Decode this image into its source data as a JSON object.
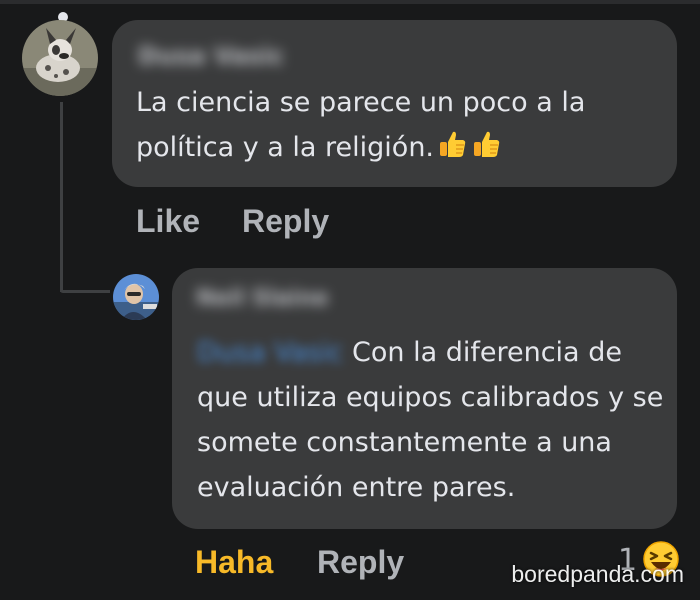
{
  "comments": [
    {
      "author": "Dusa Vasic",
      "text": "La ciencia se parece un poco a la política y a la religión.",
      "emojis": [
        "thumbs-up",
        "thumbs-up"
      ],
      "actions": {
        "like": "Like",
        "reply": "Reply"
      }
    },
    {
      "author": "Neil Slaine",
      "mention": "Dusa Vasic",
      "text": "Con la diferencia de que utiliza equipos calibrados y se somete constantemente a una evaluación entre pares.",
      "actions": {
        "reaction": "Haha",
        "reply": "Reply"
      },
      "reaction_count": "1",
      "reaction_icon": "laughing-face-icon"
    }
  ],
  "watermark": "boredpanda.com",
  "colors": {
    "background": "#18191a",
    "bubble": "#3a3b3c",
    "haha": "#f7b928",
    "muted": "#b0b3b8",
    "mention": "#4c9cf8"
  }
}
